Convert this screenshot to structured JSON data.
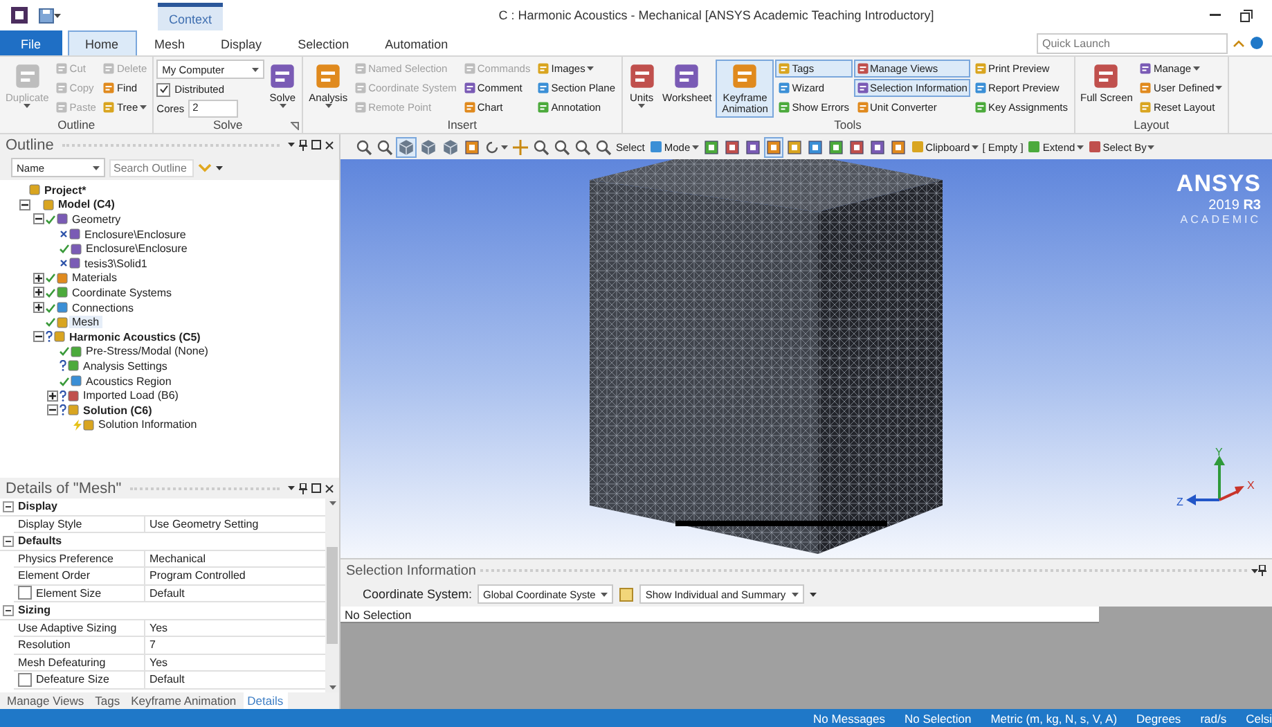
{
  "window": {
    "title": "C : Harmonic Acoustics - Mechanical [ANSYS Academic Teaching Introductory]",
    "context_tab": "Context"
  },
  "tabs": [
    {
      "label": "File",
      "kind": "file",
      "selected": false
    },
    {
      "label": "Home",
      "kind": "tab",
      "selected": true
    },
    {
      "label": "Mesh",
      "kind": "tab",
      "selected": false
    },
    {
      "label": "Display",
      "kind": "tab",
      "selected": false
    },
    {
      "label": "Selection",
      "kind": "tab",
      "selected": false
    },
    {
      "label": "Automation",
      "kind": "tab",
      "selected": false
    }
  ],
  "quick_launch": {
    "placeholder": "Quick Launch"
  },
  "ribbon": {
    "groups": [
      {
        "label": "Outline",
        "columns": [
          {
            "kind": "large",
            "label": "Duplicate",
            "disabled": true,
            "selected": false,
            "dropdown": true
          },
          {
            "kind": "stack",
            "items": [
              {
                "kind": "button",
                "label": "Cut",
                "disabled": true,
                "selected": false
              },
              {
                "kind": "button",
                "label": "Copy",
                "disabled": true,
                "selected": false
              },
              {
                "kind": "button",
                "label": "Paste",
                "disabled": true,
                "selected": false
              }
            ]
          },
          {
            "kind": "stack",
            "items": [
              {
                "kind": "button",
                "label": "Delete",
                "disabled": true,
                "selected": false
              },
              {
                "kind": "button",
                "label": "Find",
                "disabled": false,
                "selected": false
              },
              {
                "kind": "button",
                "label": "Tree",
                "disabled": false,
                "selected": false,
                "dropdown": true
              }
            ]
          }
        ]
      },
      {
        "label": "Solve",
        "launcher": true,
        "columns": [
          {
            "kind": "stack",
            "items": [
              {
                "kind": "dropdown",
                "value": "My Computer"
              },
              {
                "kind": "checkbox",
                "label": "Distributed",
                "checked": true
              },
              {
                "kind": "field",
                "label": "Cores",
                "value": "2"
              }
            ]
          },
          {
            "kind": "large",
            "label": "Solve",
            "disabled": false,
            "selected": false,
            "dropdown": true
          }
        ]
      },
      {
        "label": "Insert",
        "columns": [
          {
            "kind": "large",
            "label": "Analysis",
            "disabled": false,
            "selected": false,
            "dropdown": true
          },
          {
            "kind": "stack",
            "items": [
              {
                "kind": "button",
                "label": "Named Selection",
                "disabled": true,
                "selected": false
              },
              {
                "kind": "button",
                "label": "Coordinate System",
                "disabled": true,
                "selected": false
              },
              {
                "kind": "button",
                "label": "Remote Point",
                "disabled": true,
                "selected": false
              }
            ]
          },
          {
            "kind": "stack",
            "items": [
              {
                "kind": "button",
                "label": "Commands",
                "disabled": true,
                "selected": false
              },
              {
                "kind": "button",
                "label": "Comment",
                "disabled": false,
                "selected": false
              },
              {
                "kind": "button",
                "label": "Chart",
                "disabled": false,
                "selected": false
              }
            ]
          },
          {
            "kind": "stack",
            "items": [
              {
                "kind": "button",
                "label": "Images",
                "disabled": false,
                "selected": false,
                "dropdown": true
              },
              {
                "kind": "button",
                "label": "Section Plane",
                "disabled": false,
                "selected": false
              },
              {
                "kind": "button",
                "label": "Annotation",
                "disabled": false,
                "selected": false
              }
            ]
          }
        ]
      },
      {
        "label": "Tools",
        "columns": [
          {
            "kind": "large",
            "label": "Units",
            "disabled": false,
            "selected": false,
            "dropdown": true
          },
          {
            "kind": "large",
            "label": "Worksheet",
            "disabled": false,
            "selected": false
          },
          {
            "kind": "large",
            "label": "Keyframe Animation",
            "disabled": false,
            "selected": true
          },
          {
            "kind": "stack",
            "items": [
              {
                "kind": "button",
                "label": "Tags",
                "disabled": false,
                "selected": true
              },
              {
                "kind": "button",
                "label": "Wizard",
                "disabled": false,
                "selected": false
              },
              {
                "kind": "button",
                "label": "Show Errors",
                "disabled": false,
                "selected": false
              }
            ]
          },
          {
            "kind": "stack",
            "items": [
              {
                "kind": "button",
                "label": "Manage Views",
                "disabled": false,
                "selected": true
              },
              {
                "kind": "button",
                "label": "Selection Information",
                "disabled": false,
                "selected": true
              },
              {
                "kind": "button",
                "label": "Unit Converter",
                "disabled": false,
                "selected": false
              }
            ]
          },
          {
            "kind": "stack",
            "items": [
              {
                "kind": "button",
                "label": "Print Preview",
                "disabled": false,
                "selected": false
              },
              {
                "kind": "button",
                "label": "Report Preview",
                "disabled": false,
                "selected": false
              },
              {
                "kind": "button",
                "label": "Key Assignments",
                "disabled": false,
                "selected": false
              }
            ]
          }
        ]
      },
      {
        "label": "Layout",
        "columns": [
          {
            "kind": "large",
            "label": "Full Screen",
            "disabled": false,
            "selected": false
          },
          {
            "kind": "stack",
            "items": [
              {
                "kind": "button",
                "label": "Manage",
                "disabled": false,
                "selected": false,
                "dropdown": true
              },
              {
                "kind": "button",
                "label": "User Defined",
                "disabled": false,
                "selected": false,
                "dropdown": true
              },
              {
                "kind": "button",
                "label": "Reset Layout",
                "disabled": false,
                "selected": false
              }
            ]
          }
        ]
      }
    ]
  },
  "outline": {
    "title": "Outline",
    "filter": "Name",
    "search": {
      "placeholder": "Search Outline"
    },
    "tree": [
      {
        "label": "Project*",
        "bold": true,
        "kind": "plain",
        "selected": false,
        "children": [
          {
            "label": "Model (C4)",
            "bold": true,
            "kind": "plain",
            "expanded": true,
            "selected": false,
            "children": [
              {
                "label": "Geometry",
                "bold": false,
                "kind": "check",
                "expanded": true,
                "selected": false,
                "children": [
                  {
                    "label": "Enclosure\\Enclosure",
                    "bold": false,
                    "kind": "cross",
                    "selected": false
                  },
                  {
                    "label": "Enclosure\\Enclosure",
                    "bold": false,
                    "kind": "check",
                    "selected": false
                  },
                  {
                    "label": "tesis3\\Solid1",
                    "bold": false,
                    "kind": "cross",
                    "selected": false
                  }
                ]
              },
              {
                "label": "Materials",
                "bold": false,
                "kind": "check",
                "expanded": false,
                "selected": false
              },
              {
                "label": "Coordinate Systems",
                "bold": false,
                "kind": "check",
                "expanded": false,
                "selected": false
              },
              {
                "label": "Connections",
                "bold": false,
                "kind": "check",
                "expanded": false,
                "selected": false
              },
              {
                "label": "Mesh",
                "bold": false,
                "kind": "check",
                "selected": true
              },
              {
                "label": "Harmonic Acoustics (C5)",
                "bold": true,
                "kind": "question",
                "expanded": true,
                "selected": false,
                "children": [
                  {
                    "label": "Pre-Stress/Modal (None)",
                    "bold": false,
                    "kind": "check",
                    "selected": false
                  },
                  {
                    "label": "Analysis Settings",
                    "bold": false,
                    "kind": "question",
                    "selected": false
                  },
                  {
                    "label": "Acoustics Region",
                    "bold": false,
                    "kind": "check",
                    "selected": false
                  },
                  {
                    "label": "Imported Load (B6)",
                    "bold": false,
                    "kind": "question",
                    "expanded": false,
                    "selected": false
                  },
                  {
                    "label": "Solution (C6)",
                    "bold": true,
                    "kind": "question",
                    "expanded": true,
                    "selected": false,
                    "children": [
                      {
                        "label": "Solution Information",
                        "bold": false,
                        "kind": "lightning",
                        "selected": false
                      }
                    ]
                  }
                ]
              }
            ]
          }
        ]
      }
    ]
  },
  "details": {
    "title": "Details of \"Mesh\"",
    "sections": [
      {
        "label": "Display",
        "expanded": true,
        "rows": [
          {
            "kind": "plain",
            "label": "Display Style",
            "value": "Use Geometry Setting"
          }
        ]
      },
      {
        "label": "Defaults",
        "expanded": true,
        "rows": [
          {
            "kind": "plain",
            "label": "Physics Preference",
            "value": "Mechanical"
          },
          {
            "kind": "plain",
            "label": "Element Order",
            "value": "Program Controlled"
          },
          {
            "kind": "checkbox",
            "label": "Element Size",
            "value": "Default",
            "checked": false
          }
        ]
      },
      {
        "label": "Sizing",
        "expanded": true,
        "rows": [
          {
            "kind": "plain",
            "label": "Use Adaptive Sizing",
            "value": "Yes"
          },
          {
            "kind": "plain",
            "label": "Resolution",
            "value": "7"
          },
          {
            "kind": "plain",
            "label": "Mesh Defeaturing",
            "value": "Yes"
          },
          {
            "kind": "checkbox",
            "label": "Defeature Size",
            "value": "Default",
            "checked": false
          }
        ]
      }
    ]
  },
  "bottom_tabs": [
    {
      "label": "Manage Views",
      "selected": false
    },
    {
      "label": "Tags",
      "selected": false
    },
    {
      "label": "Keyframe Animation",
      "selected": false
    },
    {
      "label": "Details",
      "selected": true
    }
  ],
  "graphics_toolbar": [
    {
      "kind": "zoom",
      "selected": false
    },
    {
      "kind": "zoom",
      "selected": false
    },
    {
      "kind": "cube",
      "selected": true
    },
    {
      "kind": "cube",
      "selected": false
    },
    {
      "kind": "cube",
      "selected": false
    },
    {
      "kind": "square",
      "selected": false
    },
    {
      "kind": "rotate",
      "selected": false
    },
    {
      "kind": "pan",
      "selected": false
    },
    {
      "kind": "zoom",
      "selected": false
    },
    {
      "kind": "zoom",
      "selected": false
    },
    {
      "kind": "zoom",
      "selected": false
    },
    {
      "kind": "zoom",
      "selected": false
    },
    {
      "kind": "text",
      "label": "Select"
    },
    {
      "kind": "menu",
      "label": "Mode"
    },
    {
      "kind": "square",
      "selected": false
    },
    {
      "kind": "square",
      "selected": false
    },
    {
      "kind": "square",
      "selected": false
    },
    {
      "kind": "square",
      "selected": true
    },
    {
      "kind": "square",
      "selected": false
    },
    {
      "kind": "square",
      "selected": false
    },
    {
      "kind": "square",
      "selected": false
    },
    {
      "kind": "square",
      "selected": false
    },
    {
      "kind": "square",
      "selected": false
    },
    {
      "kind": "square",
      "selected": false
    },
    {
      "kind": "menu",
      "label": "Clipboard"
    },
    {
      "kind": "text",
      "label": "[ Empty ]"
    },
    {
      "kind": "menu",
      "label": "Extend"
    },
    {
      "kind": "menu",
      "label": "Select By"
    }
  ],
  "viewport": {
    "logo": {
      "name": "ANSYS",
      "version": "2019 **R3**",
      "edition": "ACADEMIC"
    },
    "axes": [
      "X",
      "Y",
      "Z"
    ]
  },
  "selection_info": {
    "title": "Selection Information",
    "coordinate_label": "Coordinate System:",
    "coordinate_value": "Global Coordinate Syste",
    "display_value": "Show Individual and Summary",
    "table_header": "No Selection"
  },
  "status_bar": [
    "No Messages",
    "No Selection",
    "Metric (m, kg, N, s, V, A)",
    "Degrees",
    "rad/s",
    "Celsi"
  ]
}
